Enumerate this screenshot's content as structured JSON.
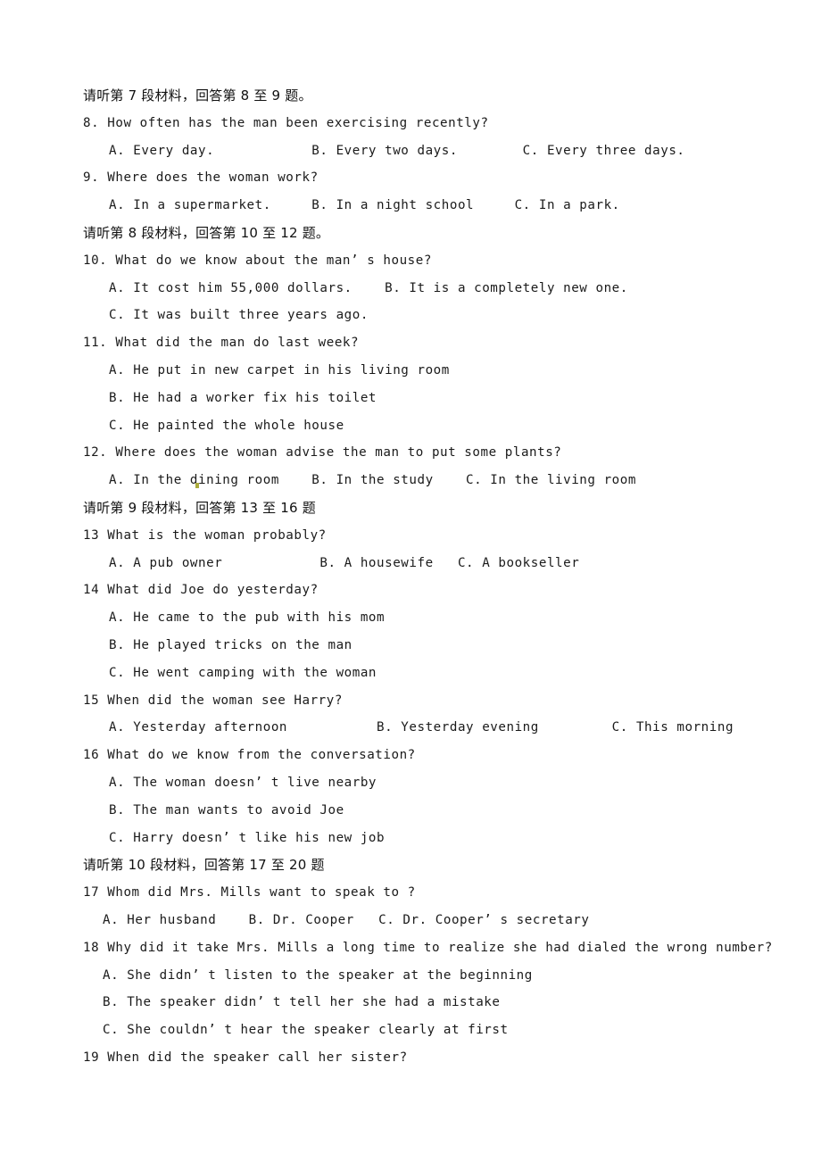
{
  "document": {
    "type": "english-listening-comprehension-exam",
    "background_color": "#ffffff",
    "text_color": "#1a1a1a"
  },
  "blocks": [
    {
      "id": "heading-7",
      "kind": "section-heading",
      "text": "请听第 7 段材料，回答第 8 至 9 题。"
    },
    {
      "id": "q8",
      "kind": "question",
      "text": "8. How often has the man been exercising recently?"
    },
    {
      "id": "q8-options",
      "kind": "options",
      "indent": "large",
      "text": "A. Every day.            B. Every two days.        C. Every three days."
    },
    {
      "id": "q9",
      "kind": "question",
      "text": "9. Where does the woman work?"
    },
    {
      "id": "q9-options",
      "kind": "options",
      "indent": "large",
      "text": "A. In a supermarket.     B. In a night school     C. In a park."
    },
    {
      "id": "heading-8",
      "kind": "section-heading",
      "text": "请听第 8 段材料，回答第 10 至 12 题。"
    },
    {
      "id": "q10",
      "kind": "question",
      "text": "10. What do we know about the man’ s house?"
    },
    {
      "id": "q10-options-1",
      "kind": "options",
      "indent": "large",
      "text": "A. It cost him 55,000 dollars.    B. It is a completely new one."
    },
    {
      "id": "q10-options-2",
      "kind": "options",
      "indent": "large",
      "text": "C. It was built three years ago."
    },
    {
      "id": "q11",
      "kind": "question",
      "text": "11. What did the man do last week?"
    },
    {
      "id": "q11-option-a",
      "kind": "options",
      "indent": "large",
      "text": "A. He put in new carpet in his living room"
    },
    {
      "id": "q11-option-b",
      "kind": "options",
      "indent": "large",
      "text": "B. He had a worker fix his toilet"
    },
    {
      "id": "q11-option-c",
      "kind": "options",
      "indent": "large",
      "text": "C. He painted the whole house"
    },
    {
      "id": "q12",
      "kind": "question",
      "text": "12. Where does the woman advise the man to put some plants?"
    },
    {
      "id": "q12-options",
      "kind": "options",
      "indent": "large",
      "text": "A. In the dining room    B. In the study    C. In the living room"
    },
    {
      "id": "heading-9",
      "kind": "section-heading",
      "text": "请听第 9 段材料，回答第 13 至 16 题"
    },
    {
      "id": "q13",
      "kind": "question",
      "text": "13 What is the woman probably?"
    },
    {
      "id": "q13-options",
      "kind": "options",
      "indent": "large",
      "text": "A. A pub owner            B. A housewife   C. A bookseller"
    },
    {
      "id": "q14",
      "kind": "question",
      "text": "14 What did Joe do yesterday?"
    },
    {
      "id": "q14-option-a",
      "kind": "options",
      "indent": "large",
      "text": "A. He came to the pub with his mom"
    },
    {
      "id": "q14-option-b",
      "kind": "options",
      "indent": "large",
      "text": "B. He played tricks on the man"
    },
    {
      "id": "q14-option-c",
      "kind": "options",
      "indent": "large",
      "text": "C. He went camping with the woman"
    },
    {
      "id": "q15",
      "kind": "question",
      "text": "15 When did the woman see Harry?"
    },
    {
      "id": "q15-options",
      "kind": "options",
      "indent": "large",
      "text": "A. Yesterday afternoon           B. Yesterday evening         C. This morning"
    },
    {
      "id": "q16",
      "kind": "question",
      "text": "16 What do we know from the conversation?"
    },
    {
      "id": "q16-option-a",
      "kind": "options",
      "indent": "large",
      "text": "A. The woman doesn’ t live nearby"
    },
    {
      "id": "q16-option-b",
      "kind": "options",
      "indent": "large",
      "text": "B. The man wants to avoid Joe"
    },
    {
      "id": "q16-option-c",
      "kind": "options",
      "indent": "large",
      "text": "C. Harry doesn’ t like his new job"
    },
    {
      "id": "heading-10",
      "kind": "section-heading",
      "text": "请听第 10 段材料，回答第 17 至 20 题"
    },
    {
      "id": "q17",
      "kind": "question",
      "text": "17 Whom did Mrs. Mills want to speak to ?"
    },
    {
      "id": "q17-options",
      "kind": "options",
      "indent": "small",
      "text": "A. Her husband    B. Dr. Cooper   C. Dr. Cooper’ s secretary"
    },
    {
      "id": "q18",
      "kind": "question",
      "text": "18 Why did it take Mrs. Mills a long time to realize she had dialed the wrong number?"
    },
    {
      "id": "q18-option-a",
      "kind": "options",
      "indent": "small",
      "text": "A. She didn’ t listen to the speaker at the beginning"
    },
    {
      "id": "q18-option-b",
      "kind": "options",
      "indent": "small",
      "text": "B. The speaker didn’ t tell her she had a mistake"
    },
    {
      "id": "q18-option-c",
      "kind": "options",
      "indent": "small",
      "text": "C. She couldn’ t hear the speaker clearly at first"
    },
    {
      "id": "q19",
      "kind": "question",
      "text": "19 When did the speaker call her sister?"
    }
  ],
  "artifacts": {
    "speck_color": "#a8a832"
  }
}
